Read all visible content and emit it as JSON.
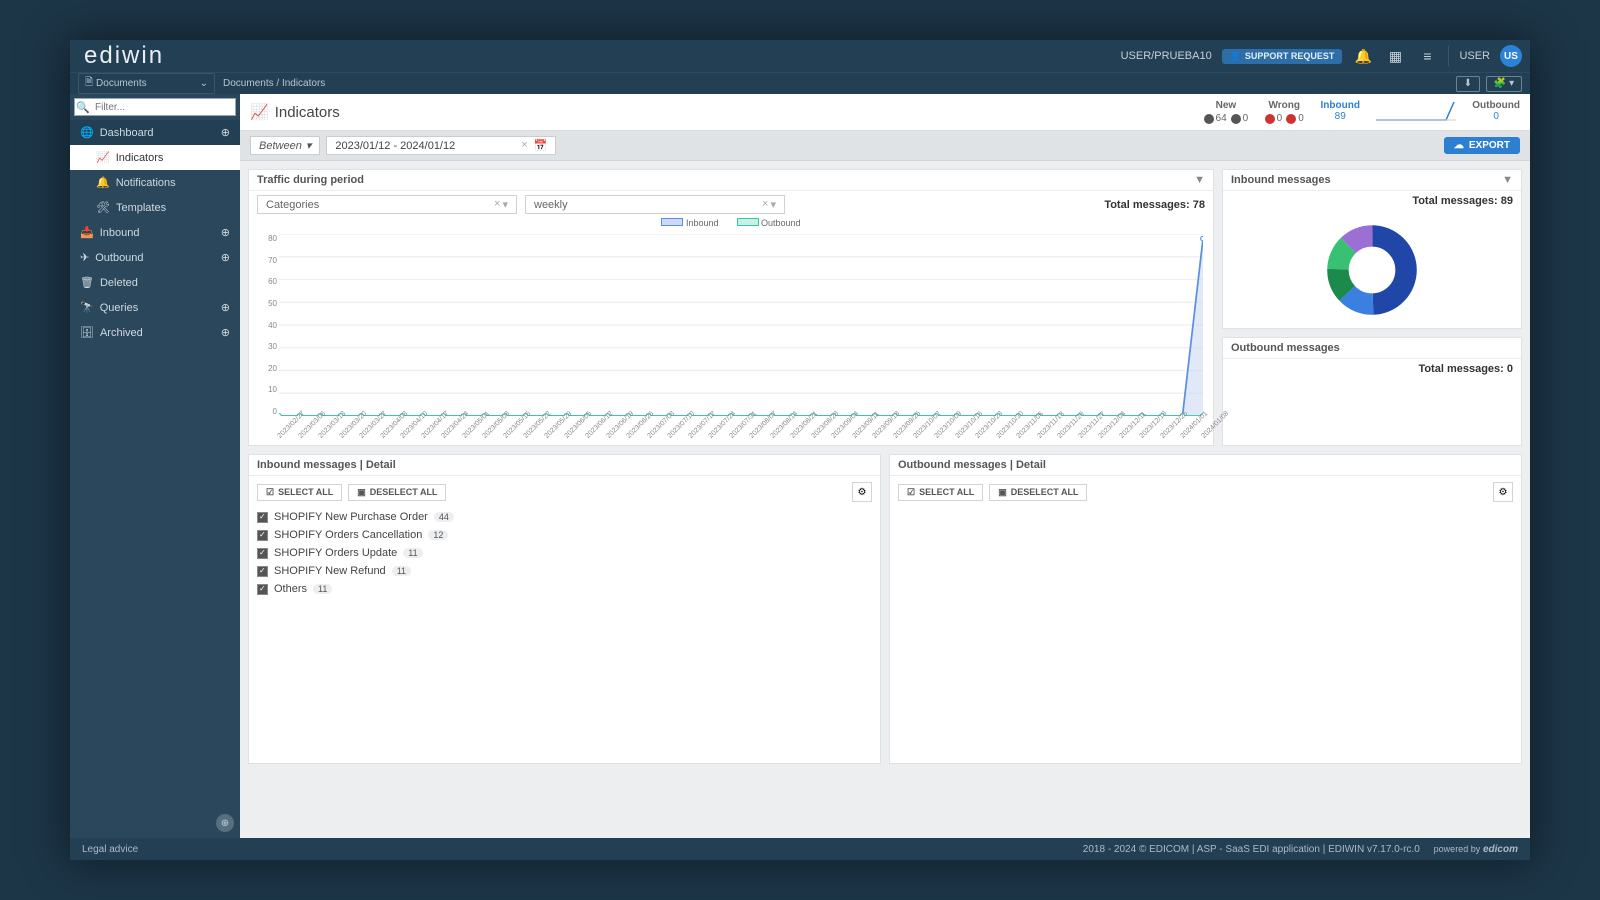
{
  "brand": "ediwin",
  "user_path": "USER/PRUEBA10",
  "support": "SUPPORT REQUEST",
  "user_label": "USER",
  "user_initials": "US",
  "crumb1": "Documents",
  "crumb2": "Documents",
  "crumb3": "Indicators",
  "filter_ph": "Filter...",
  "side_doc": "Documents",
  "side": {
    "dashboard": "Dashboard",
    "indicators": "Indicators",
    "notifications": "Notifications",
    "templates": "Templates",
    "inbound": "Inbound",
    "outbound": "Outbound",
    "deleted": "Deleted",
    "queries": "Queries",
    "archived": "Archived"
  },
  "page_title": "Indicators",
  "stats": {
    "new": {
      "label": "New",
      "eye": "64",
      "tri": "0"
    },
    "wrong": {
      "label": "Wrong",
      "warn1": "0",
      "warn2": "0"
    },
    "inbound": {
      "label": "Inbound",
      "value": "89"
    },
    "outbound": {
      "label": "Outbound",
      "value": "0"
    }
  },
  "between": "Between",
  "daterange": "2023/01/12 - 2024/01/12",
  "export": "EXPORT",
  "traffic": {
    "title": "Traffic during period",
    "categories": "Categories",
    "granularity": "weekly",
    "total": "Total messages: 78",
    "legend_in": "Inbound",
    "legend_out": "Outbound"
  },
  "inbound_panel": {
    "title": "Inbound messages",
    "total": "Total messages: 89"
  },
  "outbound_panel": {
    "title": "Outbound messages",
    "total": "Total messages: 0"
  },
  "in_detail_title": "Inbound messages | Detail",
  "out_detail_title": "Outbound messages | Detail",
  "select_all": "SELECT ALL",
  "deselect_all": "DESELECT ALL",
  "inbound_detail": [
    {
      "label": "SHOPIFY New Purchase Order",
      "count": "44"
    },
    {
      "label": "SHOPIFY Orders Cancellation",
      "count": "12"
    },
    {
      "label": "SHOPIFY Orders Update",
      "count": "11"
    },
    {
      "label": "SHOPIFY New Refund",
      "count": "11"
    },
    {
      "label": "Others",
      "count": "11"
    }
  ],
  "footer": {
    "legal": "Legal advice",
    "right": "2018 - 2024 © EDICOM | ASP - SaaS EDI application | EDIWIN v7.17.0-rc.0",
    "powered": "powered by",
    "company": "edicom"
  },
  "chart_data": {
    "type": "line",
    "x_labels": [
      "2023/02/27",
      "2023/03/06",
      "2023/03/13",
      "2023/03/20",
      "2023/03/27",
      "2023/04/03",
      "2023/04/10",
      "2023/04/17",
      "2023/04/24",
      "2023/05/01",
      "2023/05/08",
      "2023/05/15",
      "2023/05/22",
      "2023/05/29",
      "2023/06/05",
      "2023/06/12",
      "2023/06/19",
      "2023/06/26",
      "2023/07/03",
      "2023/07/10",
      "2023/07/17",
      "2023/07/24",
      "2023/07/31",
      "2023/08/07",
      "2023/08/14",
      "2023/08/21",
      "2023/08/28",
      "2023/09/04",
      "2023/09/11",
      "2023/09/18",
      "2023/09/25",
      "2023/10/02",
      "2023/10/09",
      "2023/10/16",
      "2023/10/23",
      "2023/10/30",
      "2023/11/06",
      "2023/11/13",
      "2023/11/20",
      "2023/11/27",
      "2023/12/04",
      "2023/12/11",
      "2023/12/18",
      "2023/12/25",
      "2024/01/01",
      "2024/01/08"
    ],
    "series": [
      {
        "name": "Inbound",
        "color": "#5a8fe6",
        "values": [
          0,
          0,
          0,
          0,
          0,
          0,
          0,
          0,
          0,
          0,
          0,
          0,
          0,
          0,
          0,
          0,
          0,
          0,
          0,
          0,
          0,
          0,
          0,
          0,
          0,
          0,
          0,
          0,
          0,
          0,
          0,
          0,
          0,
          0,
          0,
          0,
          0,
          0,
          0,
          0,
          0,
          0,
          0,
          0,
          0,
          78
        ]
      },
      {
        "name": "Outbound",
        "color": "#35c7a5",
        "values": [
          0,
          0,
          0,
          0,
          0,
          0,
          0,
          0,
          0,
          0,
          0,
          0,
          0,
          0,
          0,
          0,
          0,
          0,
          0,
          0,
          0,
          0,
          0,
          0,
          0,
          0,
          0,
          0,
          0,
          0,
          0,
          0,
          0,
          0,
          0,
          0,
          0,
          0,
          0,
          0,
          0,
          0,
          0,
          0,
          0,
          0
        ]
      }
    ],
    "y_ticks": [
      80,
      70,
      60,
      50,
      40,
      30,
      20,
      10,
      0
    ],
    "ylim": [
      0,
      80
    ]
  },
  "donut_data": {
    "type": "pie",
    "slices": [
      {
        "label": "SHOPIFY New Purchase Order",
        "value": 44,
        "color": "#2047a8"
      },
      {
        "label": "SHOPIFY Orders Cancellation",
        "value": 12,
        "color": "#3b7fe0"
      },
      {
        "label": "SHOPIFY Orders Update",
        "value": 11,
        "color": "#1b8a4a"
      },
      {
        "label": "SHOPIFY New Refund",
        "value": 11,
        "color": "#38c172"
      },
      {
        "label": "Others",
        "value": 11,
        "color": "#9b6fd4"
      }
    ]
  }
}
